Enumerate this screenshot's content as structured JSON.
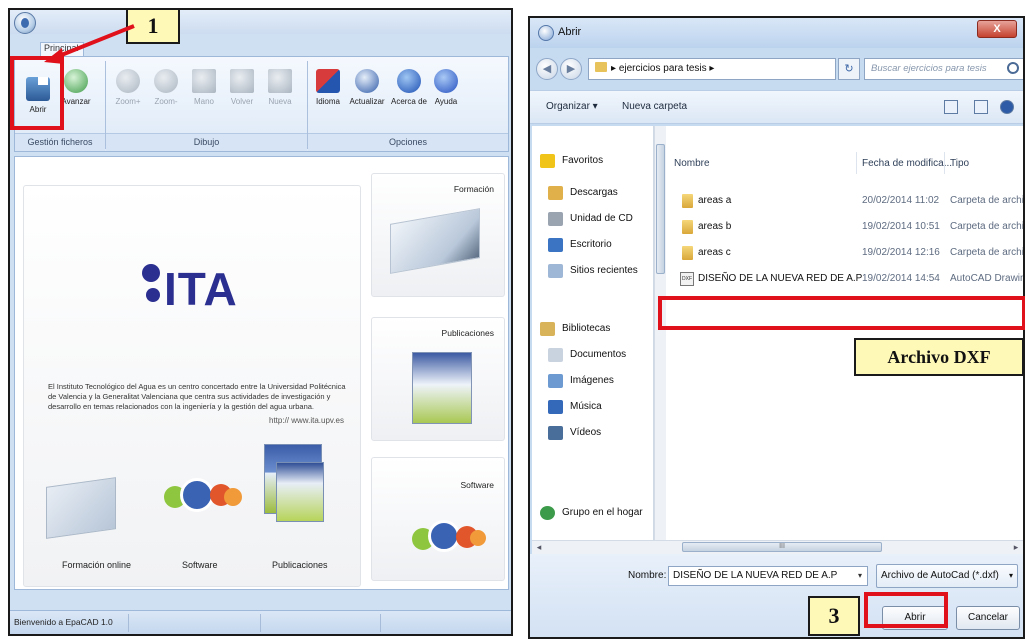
{
  "left_window": {
    "tab_label": "Principal",
    "ribbon_buttons": [
      {
        "label": "Abrir",
        "icon": "open-file-icon"
      },
      {
        "label": "Avanzar",
        "icon": "advance-icon"
      },
      {
        "label": "Zoom+",
        "icon": "zoom-in-icon"
      },
      {
        "label": "Zoom-",
        "icon": "zoom-out-icon"
      },
      {
        "label": "Mano",
        "icon": "hand-icon"
      },
      {
        "label": "Volver",
        "icon": "back-icon"
      },
      {
        "label": "Nueva",
        "icon": "new-icon"
      },
      {
        "label": "Idioma",
        "icon": "language-flag-icon"
      },
      {
        "label": "Actualizar",
        "icon": "update-icon"
      },
      {
        "label": "Acerca de",
        "icon": "info-icon"
      },
      {
        "label": "Ayuda",
        "icon": "help-icon"
      }
    ],
    "groups": {
      "files": "Gestión ficheros",
      "drawing": "Dibujo",
      "options": "Opciones"
    },
    "logo_text": "ITA",
    "description": "El Instituto Tecnológico del Agua es un centro concertado entre la Universidad Politécnica de Valencia y la Generalitat Valenciana que centra sus actividades de investigación y desarrollo en temas relacionados con la ingeniería y la gestión del agua urbana.",
    "url": "http:// www.ita.upv.es",
    "main_labels": [
      "Formación online",
      "Software",
      "Publicaciones"
    ],
    "side_panels": [
      "Formación",
      "Publicaciones",
      "Software"
    ],
    "status": "Bienvenido a EpaCAD 1.0"
  },
  "right_window": {
    "title": "Abrir",
    "close_label": "X",
    "address": "ejercicios para tesis",
    "search_placeholder": "Buscar ejercicios para tesis",
    "toolbar": {
      "organize": "Organizar ▾",
      "new_folder": "Nueva carpeta"
    },
    "nav_items": [
      {
        "label": "Favoritos",
        "icon": "star-icon",
        "color": "#f0c419"
      },
      {
        "label": "Descargas",
        "icon": "downloads-folder-icon",
        "color": "#e0b04a"
      },
      {
        "label": "Unidad de CD",
        "icon": "cd-drive-icon",
        "color": "#9aa4b1"
      },
      {
        "label": "Escritorio",
        "icon": "desktop-icon",
        "color": "#3b74c2"
      },
      {
        "label": "Sitios recientes",
        "icon": "recent-places-icon",
        "color": "#9fb7d6"
      },
      {
        "label": "Bibliotecas",
        "icon": "libraries-icon",
        "color": "#d8b35a"
      },
      {
        "label": "Documentos",
        "icon": "documents-icon",
        "color": "#c9d3e0"
      },
      {
        "label": "Imágenes",
        "icon": "pictures-icon",
        "color": "#6d9bd1"
      },
      {
        "label": "Música",
        "icon": "music-icon",
        "color": "#3468b8"
      },
      {
        "label": "Vídeos",
        "icon": "videos-icon",
        "color": "#4a6e9a"
      },
      {
        "label": "Grupo en el hogar",
        "icon": "homegroup-icon",
        "color": "#3c9b4a"
      }
    ],
    "columns": {
      "name": "Nombre",
      "date": "Fecha de modifica...",
      "type": "Tipo"
    },
    "files": [
      {
        "name": "areas a",
        "date": "20/02/2014 11:02",
        "type": "Carpeta de archivos"
      },
      {
        "name": "areas b",
        "date": "19/02/2014 10:51",
        "type": "Carpeta de archivos"
      },
      {
        "name": "areas c",
        "date": "19/02/2014 12:16",
        "type": "Carpeta de archivos"
      },
      {
        "name": "DISEÑO DE LA NUEVA RED DE A.P",
        "date": "19/02/2014 14:54",
        "type": "AutoCAD Drawing..."
      }
    ],
    "dxf_badge": "DXF",
    "scroll_glyph": "III",
    "name_label": "Nombre:",
    "name_value": "DISEÑO DE LA NUEVA RED DE A.P",
    "filetype": "Archivo de AutoCad (*.dxf)",
    "open_button": "Abrir",
    "cancel_button": "Cancelar"
  },
  "annotations": {
    "step1": "1",
    "step3": "3",
    "dxf_note": "Archivo DXF",
    "color": "#e0111b"
  }
}
